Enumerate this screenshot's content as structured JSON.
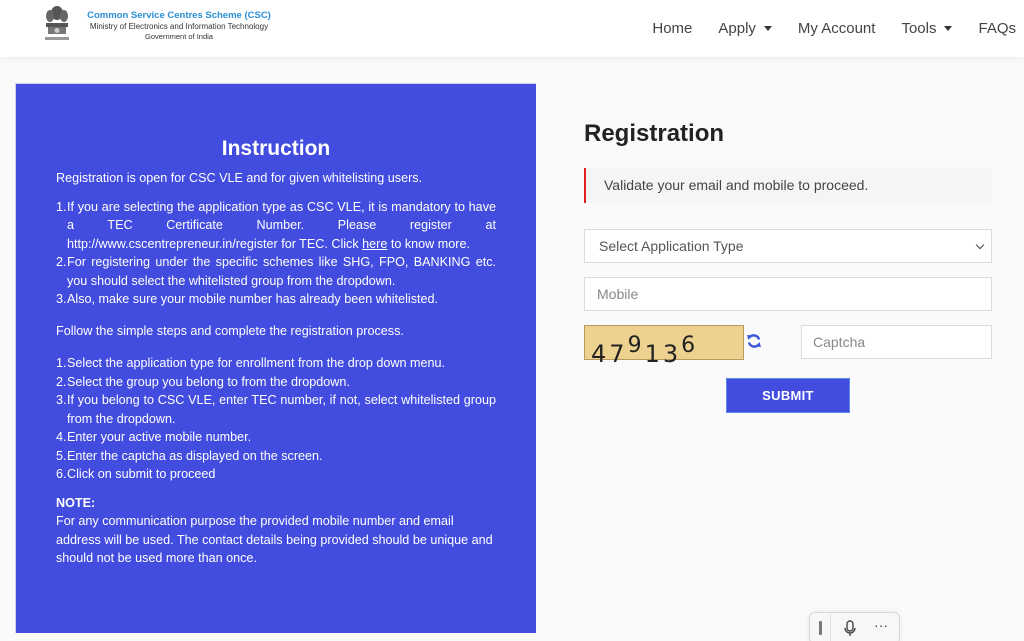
{
  "header": {
    "logo_title": "Common Service Centres Scheme (CSC)",
    "logo_subtitle": "Ministry of Electronics and Information Technology",
    "logo_gov": "Government of India",
    "nav": [
      {
        "label": "Home",
        "dropdown": false
      },
      {
        "label": "Apply",
        "dropdown": true
      },
      {
        "label": "My Account",
        "dropdown": false
      },
      {
        "label": "Tools",
        "dropdown": true
      },
      {
        "label": "FAQs",
        "dropdown": false
      }
    ]
  },
  "instruction": {
    "title": "Instruction",
    "intro": "Registration is open for CSC VLE and for given whitelisting users.",
    "list1": [
      {
        "num": "1.",
        "text_before": "If you are selecting the application type as CSC VLE, it is mandatory to have a TEC Certificate Number. Please register at http://www.cscentrepreneur.in/register for TEC. Click ",
        "link": "here",
        "text_after": " to know more."
      },
      {
        "num": "2.",
        "text": "For registering under the specific schemes like SHG, FPO, BANKING etc. you should select the whitelisted group from the dropdown."
      },
      {
        "num": "3.",
        "text": "Also, make sure your mobile number has already been whitelisted."
      }
    ],
    "follow": "Follow the simple steps and complete the registration process.",
    "list2": [
      {
        "num": "1.",
        "text": "Select the application type for enrollment from the drop down menu."
      },
      {
        "num": "2.",
        "text": "Select the group you belong to from the dropdown."
      },
      {
        "num": "3.",
        "text": "If you belong to CSC VLE, enter TEC number, if not, select whitelisted group from the dropdown."
      },
      {
        "num": "4.",
        "text": "Enter your active mobile number."
      },
      {
        "num": "5.",
        "text": "Enter the captcha as displayed on the screen."
      },
      {
        "num": "6.",
        "text": "Click on submit to proceed"
      }
    ],
    "note_label": "NOTE:",
    "note_text": "For any communication purpose the provided mobile number and email address will be used. The contact details being provided should be unique and should not be used more than once."
  },
  "registration": {
    "title": "Registration",
    "alert": "Validate your email and mobile to proceed.",
    "application_type": {
      "selected": "Select Application Type"
    },
    "mobile_placeholder": "Mobile",
    "mobile_value": "",
    "captcha_image_text": {
      "d1": "4",
      "d2": "7",
      "d3": "9",
      "d4": "1",
      "d5": "3",
      "d6": "6"
    },
    "captcha_placeholder": "Captcha",
    "captcha_value": "",
    "submit_label": "SUBMIT"
  },
  "colors": {
    "panel_blue": "#424cde",
    "alert_red": "#e02020",
    "captcha_bg": "#ecd28e",
    "logo_blue": "#2a8fd6"
  },
  "floating_toolbar": {
    "more_label": "···"
  }
}
